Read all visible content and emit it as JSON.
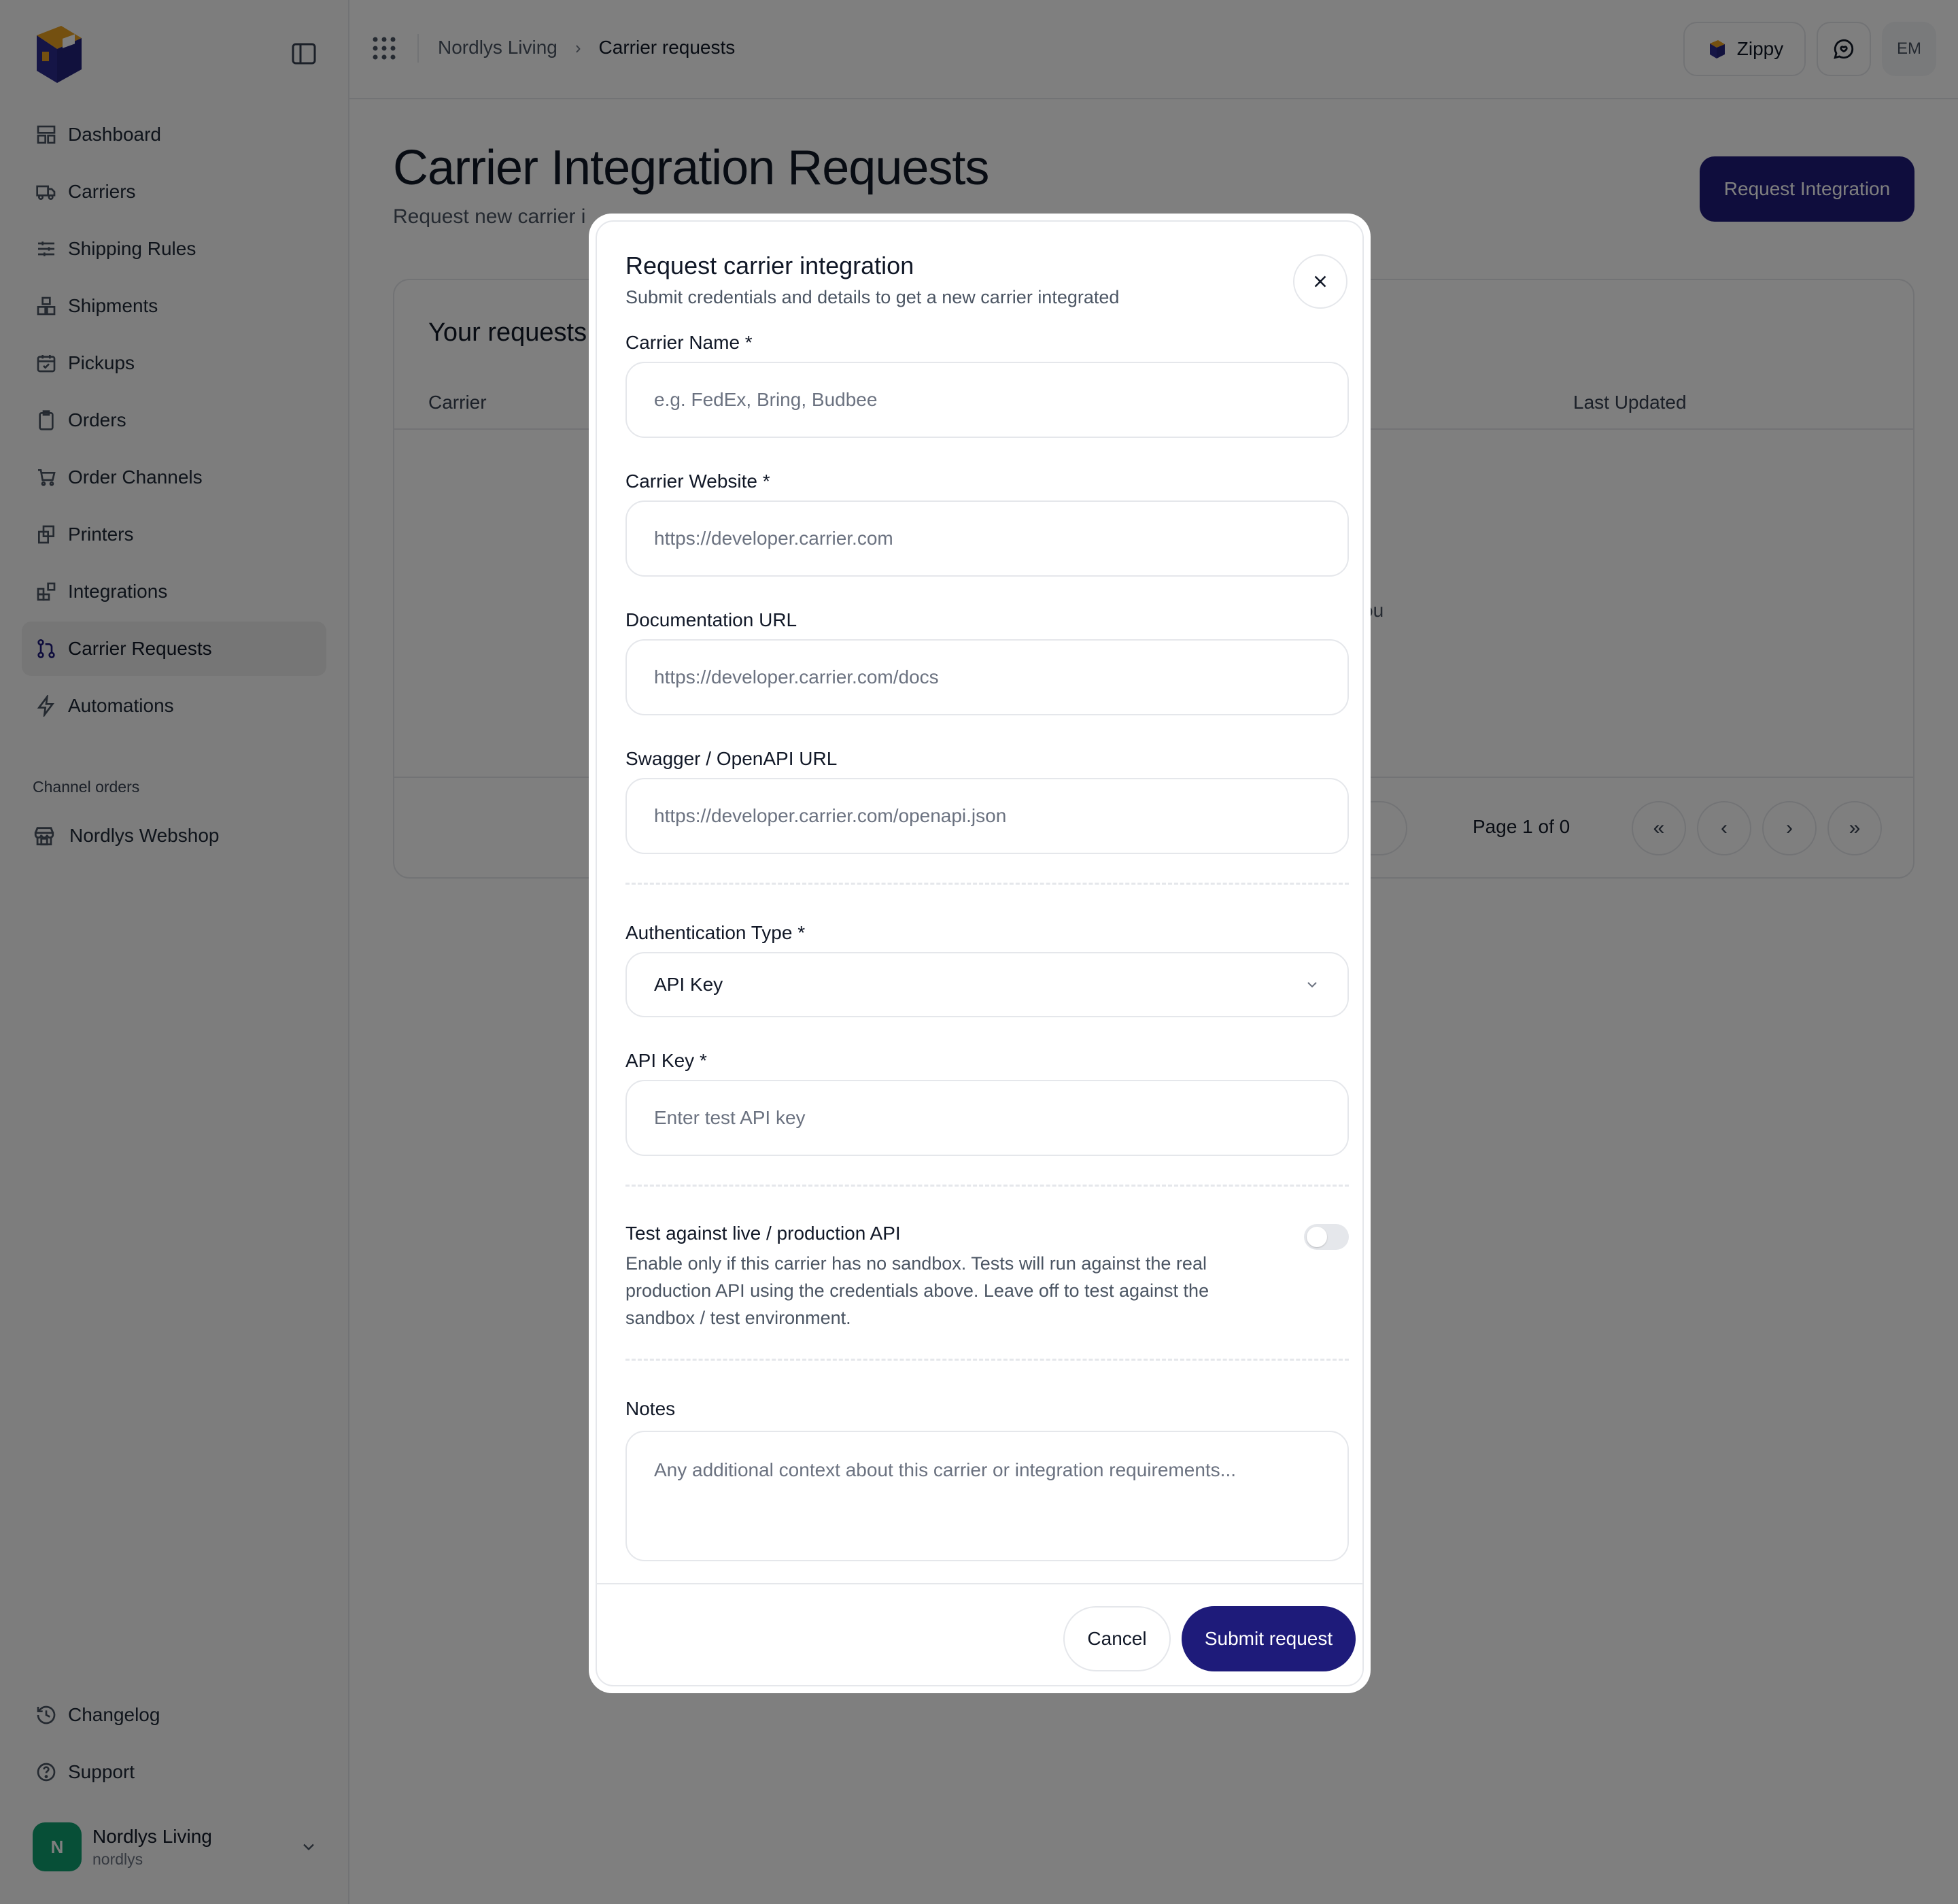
{
  "breadcrumb": {
    "org": "Nordlys Living",
    "current": "Carrier requests"
  },
  "topbar": {
    "zippy_label": "Zippy",
    "avatar_initials": "EM"
  },
  "sidebar": {
    "items": [
      {
        "label": "Dashboard",
        "icon": "dashboard-icon"
      },
      {
        "label": "Carriers",
        "icon": "truck-icon"
      },
      {
        "label": "Shipping Rules",
        "icon": "sliders-icon"
      },
      {
        "label": "Shipments",
        "icon": "boxes-icon"
      },
      {
        "label": "Pickups",
        "icon": "calendar-check-icon"
      },
      {
        "label": "Orders",
        "icon": "clipboard-icon"
      },
      {
        "label": "Order Channels",
        "icon": "cart-icon"
      },
      {
        "label": "Printers",
        "icon": "printer-icon"
      },
      {
        "label": "Integrations",
        "icon": "blocks-icon"
      },
      {
        "label": "Carrier Requests",
        "icon": "git-pull-icon",
        "active": true
      },
      {
        "label": "Automations",
        "icon": "zap-icon"
      }
    ],
    "section_label": "Channel orders",
    "channel": "Nordlys Webshop",
    "changelog": "Changelog",
    "support": "Support",
    "account": {
      "initial": "N",
      "name": "Nordlys Living",
      "slug": "nordlys"
    }
  },
  "page": {
    "title": "Carrier Integration Requests",
    "subtitle": "Request new carrier i",
    "request_button": "Request Integration",
    "card_title": "Your requests",
    "col_carrier": "Carrier",
    "col_updated": "Last Updated",
    "empty_tail": "ou",
    "pagination": "Page 1 of 0"
  },
  "modal": {
    "title": "Request carrier integration",
    "subtitle": "Submit credentials and details to get a new carrier integrated",
    "carrier_name_label": "Carrier Name *",
    "carrier_name_placeholder": "e.g. FedEx, Bring, Budbee",
    "website_label": "Carrier Website *",
    "website_placeholder": "https://developer.carrier.com",
    "docs_label": "Documentation URL",
    "docs_placeholder": "https://developer.carrier.com/docs",
    "swagger_label": "Swagger / OpenAPI URL",
    "swagger_placeholder": "https://developer.carrier.com/openapi.json",
    "auth_label": "Authentication Type *",
    "auth_value": "API Key",
    "api_key_label": "API Key *",
    "api_key_placeholder": "Enter test API key",
    "live_title": "Test against live / production API",
    "live_desc": "Enable only if this carrier has no sandbox. Tests will run against the real production API using the credentials above. Leave off to test against the sandbox / test environment.",
    "live_enabled": false,
    "notes_label": "Notes",
    "notes_placeholder": "Any additional context about this carrier or integration requirements...",
    "cancel": "Cancel",
    "submit": "Submit request"
  },
  "colors": {
    "primary": "#1e1b7a",
    "avatar": "#0f9f6e",
    "overlay": "rgba(0,0,0,0.5)"
  }
}
